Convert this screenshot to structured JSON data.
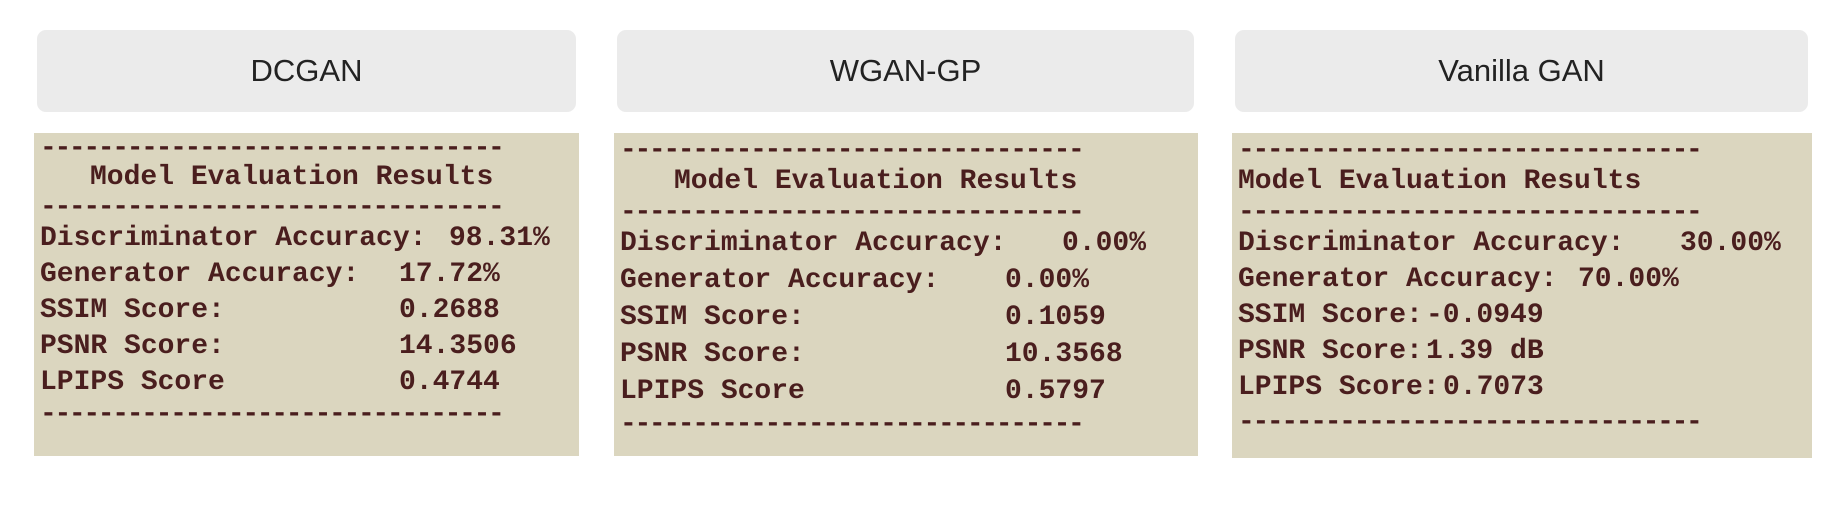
{
  "divider": "--------------------------------",
  "panels": [
    {
      "tab_label": "DCGAN",
      "header": "Model Evaluation Results",
      "rows": [
        {
          "label": "Discriminator Accuracy:",
          "value": "98.31%"
        },
        {
          "label": "Generator Accuracy:",
          "value": "17.72%"
        },
        {
          "label": "SSIM Score:",
          "value": "0.2688"
        },
        {
          "label": "PSNR Score:",
          "value": "14.3506"
        },
        {
          "label": "LPIPS Score",
          "value": "0.4744"
        }
      ]
    },
    {
      "tab_label": "WGAN-GP",
      "header": "Model Evaluation Results",
      "rows": [
        {
          "label": "Discriminator Accuracy:",
          "value": "0.00%"
        },
        {
          "label": "Generator Accuracy:",
          "value": "0.00%"
        },
        {
          "label": "SSIM Score:",
          "value": "0.1059"
        },
        {
          "label": "PSNR Score:",
          "value": "10.3568"
        },
        {
          "label": "LPIPS Score",
          "value": "0.5797"
        }
      ]
    },
    {
      "tab_label": "Vanilla GAN",
      "header": "Model Evaluation Results",
      "rows": [
        {
          "label": "Discriminator Accuracy:",
          "value": "30.00%"
        },
        {
          "label": "Generator Accuracy:",
          "value": "70.00%"
        },
        {
          "label": "SSIM Score:",
          "value": "-0.0949"
        },
        {
          "label": "PSNR Score:",
          "value": "1.39 dB"
        },
        {
          "label": "LPIPS Score:",
          "value": "0.7073"
        }
      ]
    }
  ]
}
